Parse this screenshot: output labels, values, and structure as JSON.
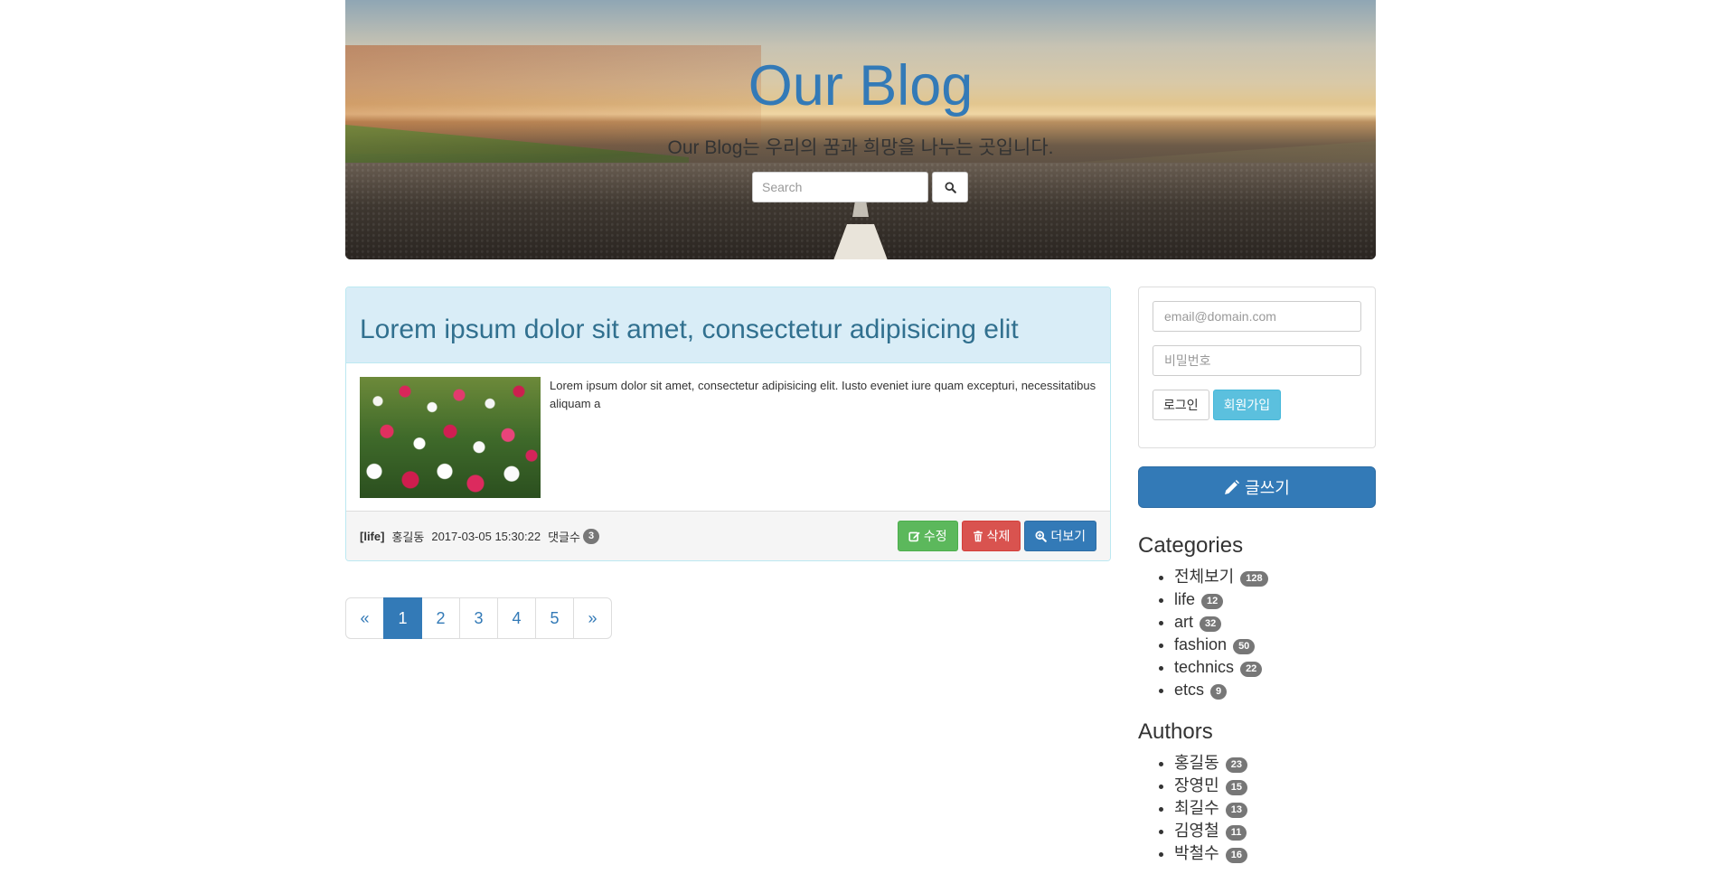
{
  "header": {
    "title": "Our Blog",
    "subtitle": "Our Blog는 우리의 꿈과 희망을 나누는 곳입니다.",
    "search_placeholder": "Search"
  },
  "post": {
    "title": "Lorem ipsum dolor sit amet, consectetur adipisicing elit",
    "excerpt": "Lorem ipsum dolor sit amet, consectetur adipisicing elit. Iusto eveniet iure quam excepturi, necessitatibus aliquam a",
    "category": "[life]",
    "author": "홍길동",
    "date": "2017-03-05 15:30:22",
    "comments_label": "댓글수",
    "comments_count": "3",
    "edit_label": "수정",
    "delete_label": "삭제",
    "more_label": "더보기"
  },
  "pagination": {
    "prev": "«",
    "pages": [
      "1",
      "2",
      "3",
      "4",
      "5"
    ],
    "next": "»",
    "active": "1"
  },
  "login": {
    "email_placeholder": "email@domain.com",
    "password_placeholder": "비밀번호",
    "login_label": "로그인",
    "signup_label": "회원가입"
  },
  "write_label": "글쓰기",
  "categories": {
    "heading": "Categories",
    "items": [
      {
        "label": "전체보기",
        "count": "128"
      },
      {
        "label": "life",
        "count": "12"
      },
      {
        "label": "art",
        "count": "32"
      },
      {
        "label": "fashion",
        "count": "50"
      },
      {
        "label": "technics",
        "count": "22"
      },
      {
        "label": "etcs",
        "count": "9"
      }
    ]
  },
  "authors": {
    "heading": "Authors",
    "items": [
      {
        "label": "홍길동",
        "count": "23"
      },
      {
        "label": "장영민",
        "count": "15"
      },
      {
        "label": "최길수",
        "count": "13"
      },
      {
        "label": "김영철",
        "count": "11"
      },
      {
        "label": "박철수",
        "count": "16"
      }
    ]
  },
  "colors": {
    "primary": "#337ab7",
    "success": "#5cb85c",
    "danger": "#d9534f",
    "info": "#5bc0de",
    "panel_heading": "#d9edf7"
  }
}
